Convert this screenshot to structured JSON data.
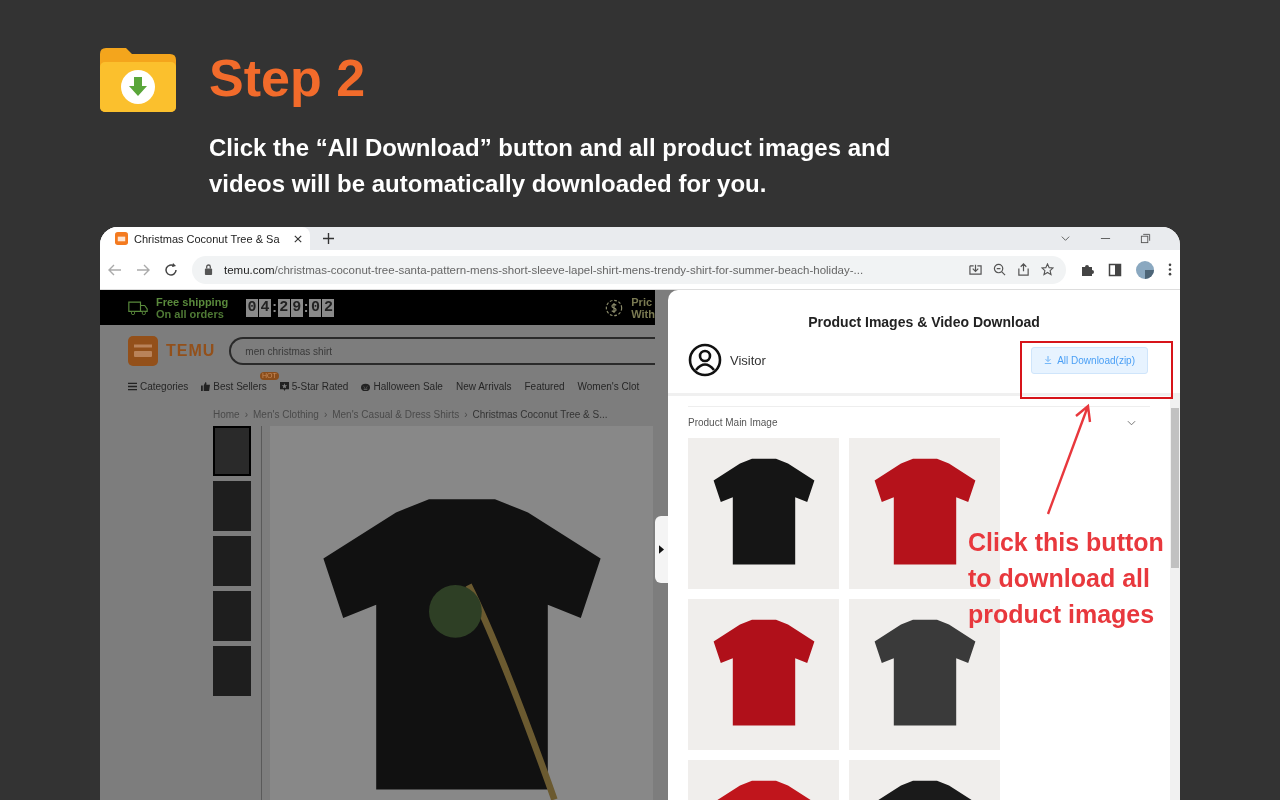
{
  "header": {
    "title": "Step 2",
    "description": "Click the  “All Download” button and all product images and\nvideos will be automatically downloaded for you."
  },
  "browser": {
    "tabs": [
      {
        "title": "Christmas Coconut Tree & Sa",
        "selected": true
      }
    ],
    "url_domain": "temu.com",
    "url_path": "/christmas-coconut-tree-santa-pattern-mens-short-sleeve-lapel-shirt-mens-trendy-shirt-for-summer-beach-holiday-..."
  },
  "store_page": {
    "banner": {
      "shipping_line1": "Free shipping",
      "shipping_line2": "On all orders",
      "countdown": [
        "0",
        "4",
        ":",
        "2",
        "9",
        ":",
        "0",
        "2"
      ],
      "price_line1": "Pric",
      "price_line2": "With"
    },
    "logo_text": "TEMU",
    "search": {
      "value": "men christmas shirt"
    },
    "nav": [
      {
        "label": "Categories",
        "kind": "menu"
      },
      {
        "label": "Best Sellers",
        "kind": "thumb",
        "badge": "HOT"
      },
      {
        "label": "5-Star Rated",
        "kind": "star"
      },
      {
        "label": "Halloween Sale",
        "kind": "pumpkin"
      },
      {
        "label": "New Arrivals",
        "kind": "plain"
      },
      {
        "label": "Featured",
        "kind": "plain"
      },
      {
        "label": "Women's Clot",
        "kind": "plain"
      }
    ],
    "breadcrumb_separator": "›",
    "breadcrumb": [
      "Home",
      "Men's Clothing",
      "Men's Casual & Dress Shirts",
      "Christmas Coconut Tree & S..."
    ],
    "thumbnails": [
      {
        "selected": true
      },
      {
        "selected": false
      },
      {
        "selected": false
      },
      {
        "selected": false
      },
      {
        "selected": false
      }
    ]
  },
  "panel": {
    "title": "Product Images & Video Download",
    "user": "Visitor",
    "download_button": "All Download(zip)",
    "section": {
      "title": "Product Main Image",
      "expanded": true,
      "images": [
        {
          "color": "#151515"
        },
        {
          "color": "#b5121b"
        },
        {
          "color": "#b0101a"
        },
        {
          "color": "#3a3a3a"
        },
        {
          "color": "#c0151c"
        },
        {
          "color": "#1a1a1a"
        }
      ]
    }
  },
  "annotation": {
    "text": "Click this button\nto download all\nproduct images"
  }
}
